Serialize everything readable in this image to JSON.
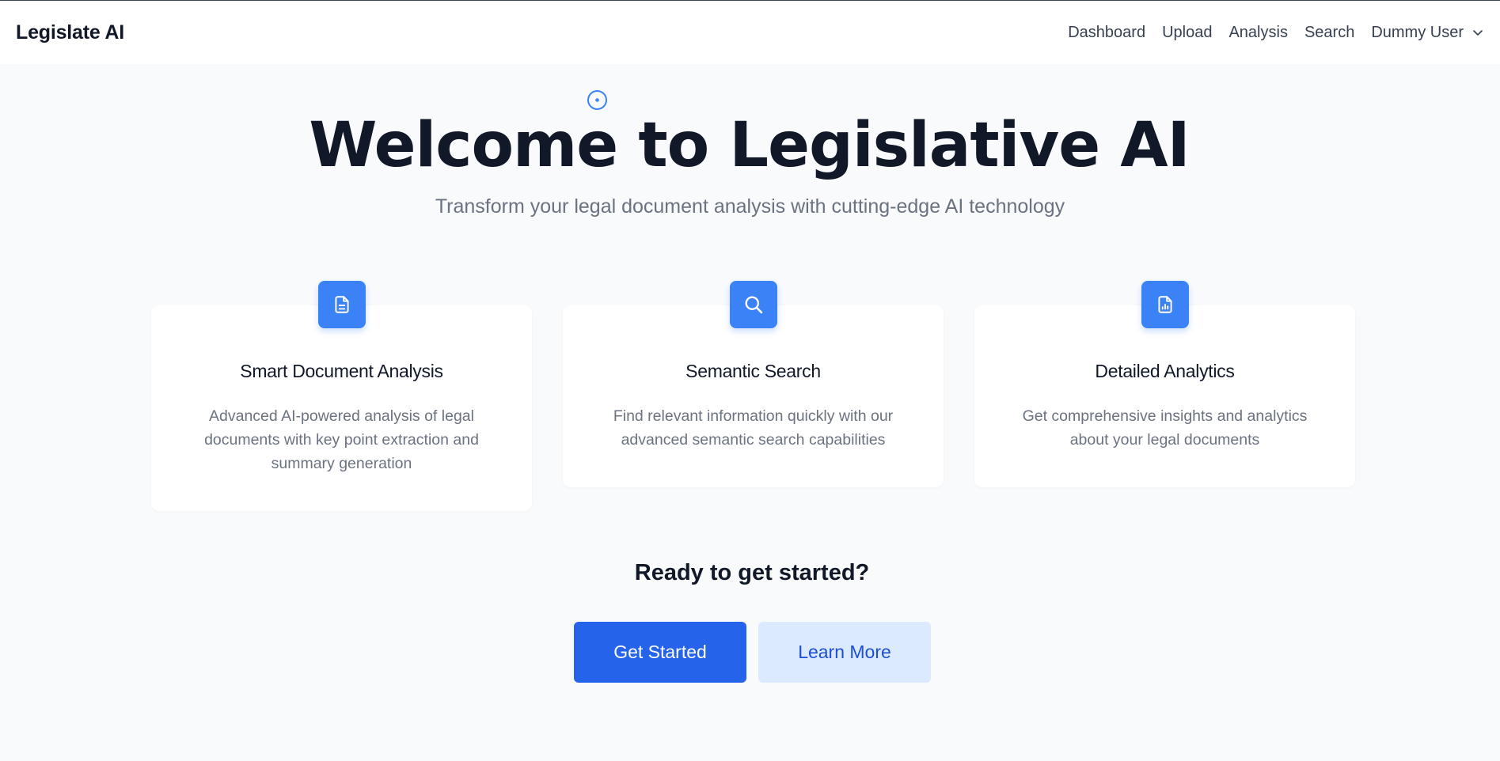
{
  "header": {
    "brand": "Legislate AI",
    "nav": [
      "Dashboard",
      "Upload",
      "Analysis",
      "Search"
    ],
    "user": "Dummy User"
  },
  "hero": {
    "title": "Welcome to Legislative AI",
    "subtitle": "Transform your legal document analysis with cutting-edge AI technology"
  },
  "features": [
    {
      "icon": "document-icon",
      "title": "Smart Document Analysis",
      "description": "Advanced AI-powered analysis of legal documents with key point extraction and summary generation"
    },
    {
      "icon": "search-icon",
      "title": "Semantic Search",
      "description": "Find relevant information quickly with our advanced semantic search capabilities"
    },
    {
      "icon": "analytics-icon",
      "title": "Detailed Analytics",
      "description": "Get comprehensive insights and analytics about your legal documents"
    }
  ],
  "cta": {
    "title": "Ready to get started?",
    "primary": "Get Started",
    "secondary": "Learn More"
  },
  "colors": {
    "accent": "#3b82f6",
    "primary_button": "#2563eb",
    "secondary_button": "#dbeafe",
    "background": "#f8fafc"
  }
}
